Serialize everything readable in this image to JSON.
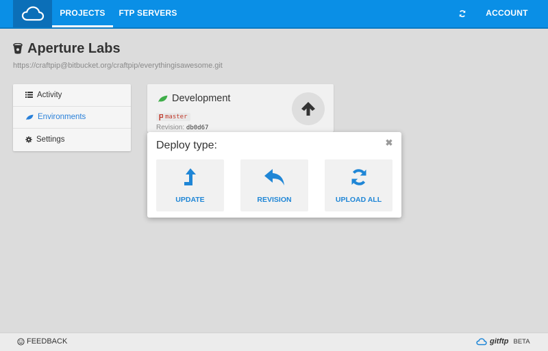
{
  "nav": {
    "logo_icon": "cloud-icon",
    "items": [
      {
        "label": "PROJECTS",
        "active": true
      },
      {
        "label": "FTP SERVERS",
        "active": false
      }
    ],
    "sync_icon": "refresh-icon",
    "account_label": "ACCOUNT"
  },
  "project": {
    "title": "Aperture Labs",
    "title_icon": "bitbucket-icon",
    "repo_url": "https://craftpip@bitbucket.org/craftpip/everythingisawesome.git"
  },
  "sidebar": {
    "items": [
      {
        "label": "Activity",
        "icon": "list-icon",
        "active": false
      },
      {
        "label": "Environments",
        "icon": "leaf-icon",
        "active": true
      },
      {
        "label": "Settings",
        "icon": "gear-icon",
        "active": false
      }
    ]
  },
  "environment": {
    "name": "Development",
    "icon": "leaf-icon",
    "branch": "master",
    "revision_label": "Revision:",
    "revision_hash": "db0d67",
    "deploy_icon": "arrow-up-icon"
  },
  "modal": {
    "title": "Deploy type:",
    "close_icon": "close-icon",
    "options": [
      {
        "label": "UPDATE",
        "icon": "level-up-icon"
      },
      {
        "label": "REVISION",
        "icon": "reply-icon"
      },
      {
        "label": "UPLOAD ALL",
        "icon": "refresh-icon"
      }
    ]
  },
  "footer": {
    "feedback_label": "FEEDBACK",
    "brand_git": "git",
    "brand_ftp": "ftp",
    "brand_beta": "BETA"
  },
  "colors": {
    "primary": "#0a8fe6",
    "accent_blue": "#1f86d6",
    "leaf_green": "#3fae49",
    "branch_red": "#c0392b"
  }
}
